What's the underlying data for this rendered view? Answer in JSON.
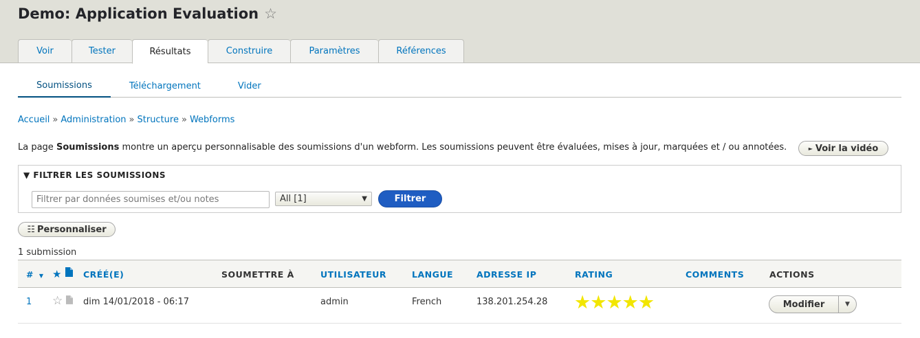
{
  "header": {
    "title": "Demo: Application Evaluation",
    "tabs": [
      {
        "label": "Voir"
      },
      {
        "label": "Tester"
      },
      {
        "label": "Résultats"
      },
      {
        "label": "Construire"
      },
      {
        "label": "Paramètres"
      },
      {
        "label": "Références"
      }
    ]
  },
  "subtabs": [
    {
      "label": "Soumissions"
    },
    {
      "label": "Téléchargement"
    },
    {
      "label": "Vider"
    }
  ],
  "breadcrumb": [
    "Accueil",
    "Administration",
    "Structure",
    "Webforms"
  ],
  "breadcrumb_sep": "»",
  "intro": {
    "prefix": "La page ",
    "strong": "Soumissions",
    "suffix": " montre un aperçu personnalisable des soumissions d'un webform. Les soumissions peuvent être évaluées, mises à jour, marquées et / ou annotées."
  },
  "video_button": {
    "label": "Voir la vidéo"
  },
  "filter": {
    "legend": "FILTRER LES SOUMISSIONS",
    "input_placeholder": "Filtrer par données soumises et/ou notes",
    "select_value": "All [1]",
    "button_label": "Filtrer"
  },
  "customize_button": {
    "label": "Personnaliser"
  },
  "count": "1 submission",
  "table": {
    "headers": {
      "num": "#",
      "created": "CRÉÉ(E)",
      "submit_to": "SOUMETTRE À",
      "user": "UTILISATEUR",
      "lang": "LANGUE",
      "ip": "ADRESSE IP",
      "rating": "RATING",
      "comments": "COMMENTS",
      "actions": "ACTIONS"
    },
    "rows": [
      {
        "num": "1",
        "created": "dim 14/01/2018 - 06:17",
        "submit_to": "",
        "user": "admin",
        "lang": "French",
        "ip": "138.201.254.28",
        "rating": 5,
        "comments": "",
        "action": "Modifier"
      }
    ]
  },
  "colors": {
    "link": "#0074bd",
    "primary_button": "#1f5dc2",
    "star": "#f2e600",
    "header_bg": "#e0e0d8"
  }
}
